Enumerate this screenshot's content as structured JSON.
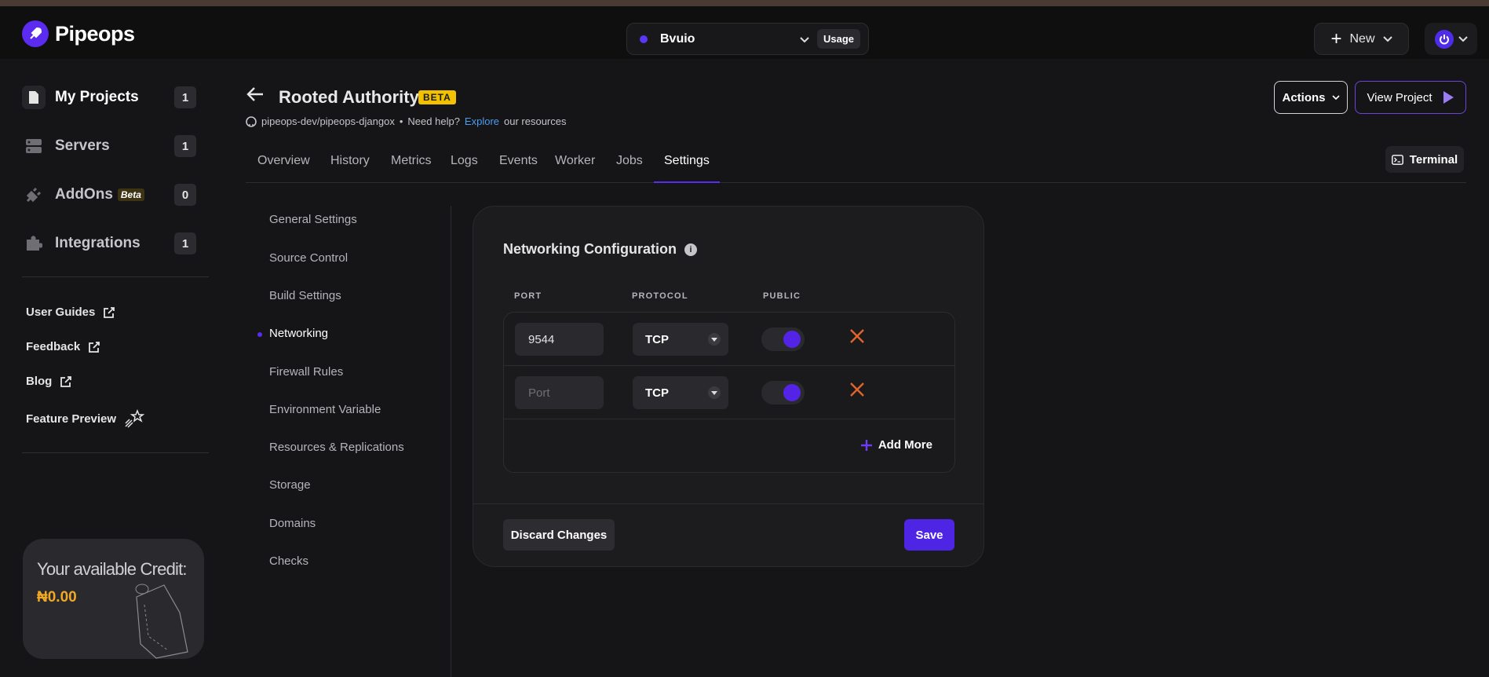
{
  "app": {
    "name": "Pipeops"
  },
  "workspace": {
    "name": "Bvuio",
    "usage_label": "Usage"
  },
  "topbar": {
    "new_label": "New"
  },
  "sidebar": {
    "items": [
      {
        "label": "My Projects",
        "count": "1"
      },
      {
        "label": "Servers",
        "count": "1"
      },
      {
        "label": "AddOns",
        "tag": "Beta",
        "count": "0"
      },
      {
        "label": "Integrations",
        "count": "1"
      }
    ],
    "links": [
      {
        "label": "User Guides"
      },
      {
        "label": "Feedback"
      },
      {
        "label": "Blog"
      },
      {
        "label": "Feature Preview"
      }
    ],
    "credit": {
      "title": "Your available Credit:",
      "value": "₦0.00"
    }
  },
  "project": {
    "title": "Rooted Authority",
    "badge": "BETA",
    "repo": "pipeops-dev/pipeops-djangox",
    "help_text": "Need help?",
    "help_link": "Explore",
    "help_suffix": "our resources",
    "actions_label": "Actions",
    "view_project_label": "View Project"
  },
  "tabs": [
    {
      "label": "Overview"
    },
    {
      "label": "History"
    },
    {
      "label": "Metrics"
    },
    {
      "label": "Logs"
    },
    {
      "label": "Events"
    },
    {
      "label": "Worker"
    },
    {
      "label": "Jobs"
    },
    {
      "label": "Settings"
    }
  ],
  "terminal_label": "Terminal",
  "settings_nav": [
    {
      "label": "General Settings"
    },
    {
      "label": "Source Control"
    },
    {
      "label": "Build Settings"
    },
    {
      "label": "Networking"
    },
    {
      "label": "Firewall Rules"
    },
    {
      "label": "Environment Variable"
    },
    {
      "label": "Resources & Replications"
    },
    {
      "label": "Storage"
    },
    {
      "label": "Domains"
    },
    {
      "label": "Checks"
    }
  ],
  "networking": {
    "title": "Networking Configuration",
    "columns": {
      "port": "PORT",
      "protocol": "PROTOCOL",
      "public": "PUBLIC"
    },
    "rows": [
      {
        "port": "9544",
        "port_placeholder": "Port",
        "protocol": "TCP",
        "public": true
      },
      {
        "port": "",
        "port_placeholder": "Port",
        "protocol": "TCP",
        "public": true
      }
    ],
    "add_more_label": "Add More",
    "discard_label": "Discard Changes",
    "save_label": "Save"
  },
  "colors": {
    "accent": "#5b2bf0",
    "badge": "#f2c200",
    "link": "#4d9cf0",
    "delete": "#e0652a",
    "credit": "#f0a825"
  }
}
